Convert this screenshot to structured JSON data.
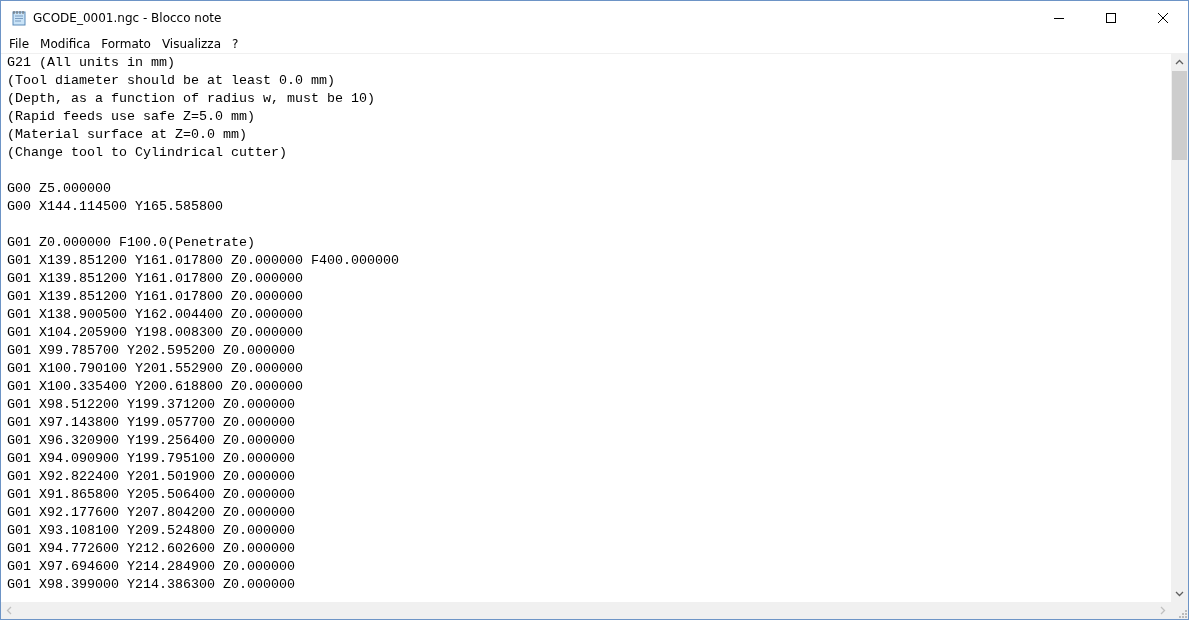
{
  "window": {
    "title": "GCODE_0001.ngc - Blocco note"
  },
  "menu": [
    "File",
    "Modifica",
    "Formato",
    "Visualizza",
    "?"
  ],
  "editor": {
    "blocks": [
      [
        "G21 (All units in mm)",
        "(Tool diameter should be at least 0.0 mm)",
        "(Depth, as a function of radius w, must be 10)",
        "(Rapid feeds use safe Z=5.0 mm)",
        "(Material surface at Z=0.0 mm)",
        "(Change tool to Cylindrical cutter)"
      ],
      [
        "G00 Z5.000000",
        "G00 X144.114500 Y165.585800"
      ],
      [
        "G01 Z0.000000 F100.0(Penetrate)",
        "G01 X139.851200 Y161.017800 Z0.000000 F400.000000",
        "G01 X139.851200 Y161.017800 Z0.000000",
        "G01 X139.851200 Y161.017800 Z0.000000",
        "G01 X138.900500 Y162.004400 Z0.000000",
        "G01 X104.205900 Y198.008300 Z0.000000",
        "G01 X99.785700 Y202.595200 Z0.000000",
        "G01 X100.790100 Y201.552900 Z0.000000",
        "G01 X100.335400 Y200.618800 Z0.000000",
        "G01 X98.512200 Y199.371200 Z0.000000",
        "G01 X97.143800 Y199.057700 Z0.000000",
        "G01 X96.320900 Y199.256400 Z0.000000",
        "G01 X94.090900 Y199.795100 Z0.000000",
        "G01 X92.822400 Y201.501900 Z0.000000",
        "G01 X91.865800 Y205.506400 Z0.000000",
        "G01 X92.177600 Y207.804200 Z0.000000",
        "G01 X93.108100 Y209.524800 Z0.000000",
        "G01 X94.772600 Y212.602600 Z0.000000",
        "G01 X97.694600 Y214.284900 Z0.000000",
        "G01 X98.399000 Y214.386300 Z0.000000"
      ]
    ]
  }
}
